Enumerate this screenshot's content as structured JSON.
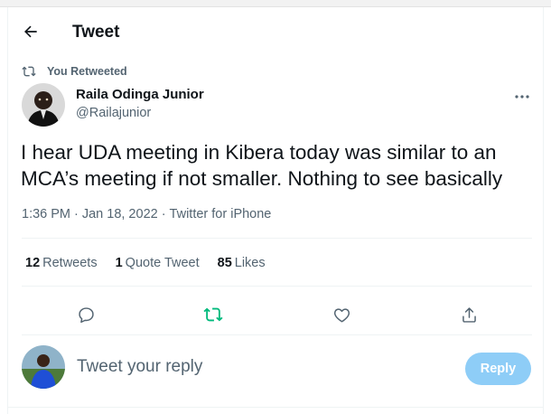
{
  "header": {
    "title": "Tweet"
  },
  "retweet_context": {
    "label": "You Retweeted"
  },
  "author": {
    "name": "Raila Odinga Junior",
    "handle": "@Railajunior"
  },
  "tweet": {
    "text": "I hear UDA meeting in Kibera today was similar to an MCA’s meeting if not smaller. Nothing to see basically",
    "time": "1:36 PM",
    "date": "Jan 18, 2022",
    "source": "Twitter for iPhone"
  },
  "stats": {
    "retweets": {
      "count": "12",
      "label": "Retweets"
    },
    "quote_tweets": {
      "count": "1",
      "label": "Quote Tweet"
    },
    "likes": {
      "count": "85",
      "label": "Likes"
    }
  },
  "actions": {
    "reply_icon": "comment-icon",
    "retweet_icon": "retweet-icon",
    "like_icon": "heart-icon",
    "share_icon": "share-icon",
    "retweeted_color": "#00ba7c"
  },
  "reply_box": {
    "placeholder": "Tweet your reply",
    "button_label": "Reply"
  },
  "colors": {
    "accent": "#1d9bf0",
    "reply_button_disabled": "#8ecdf7",
    "secondary_text": "#536471"
  }
}
